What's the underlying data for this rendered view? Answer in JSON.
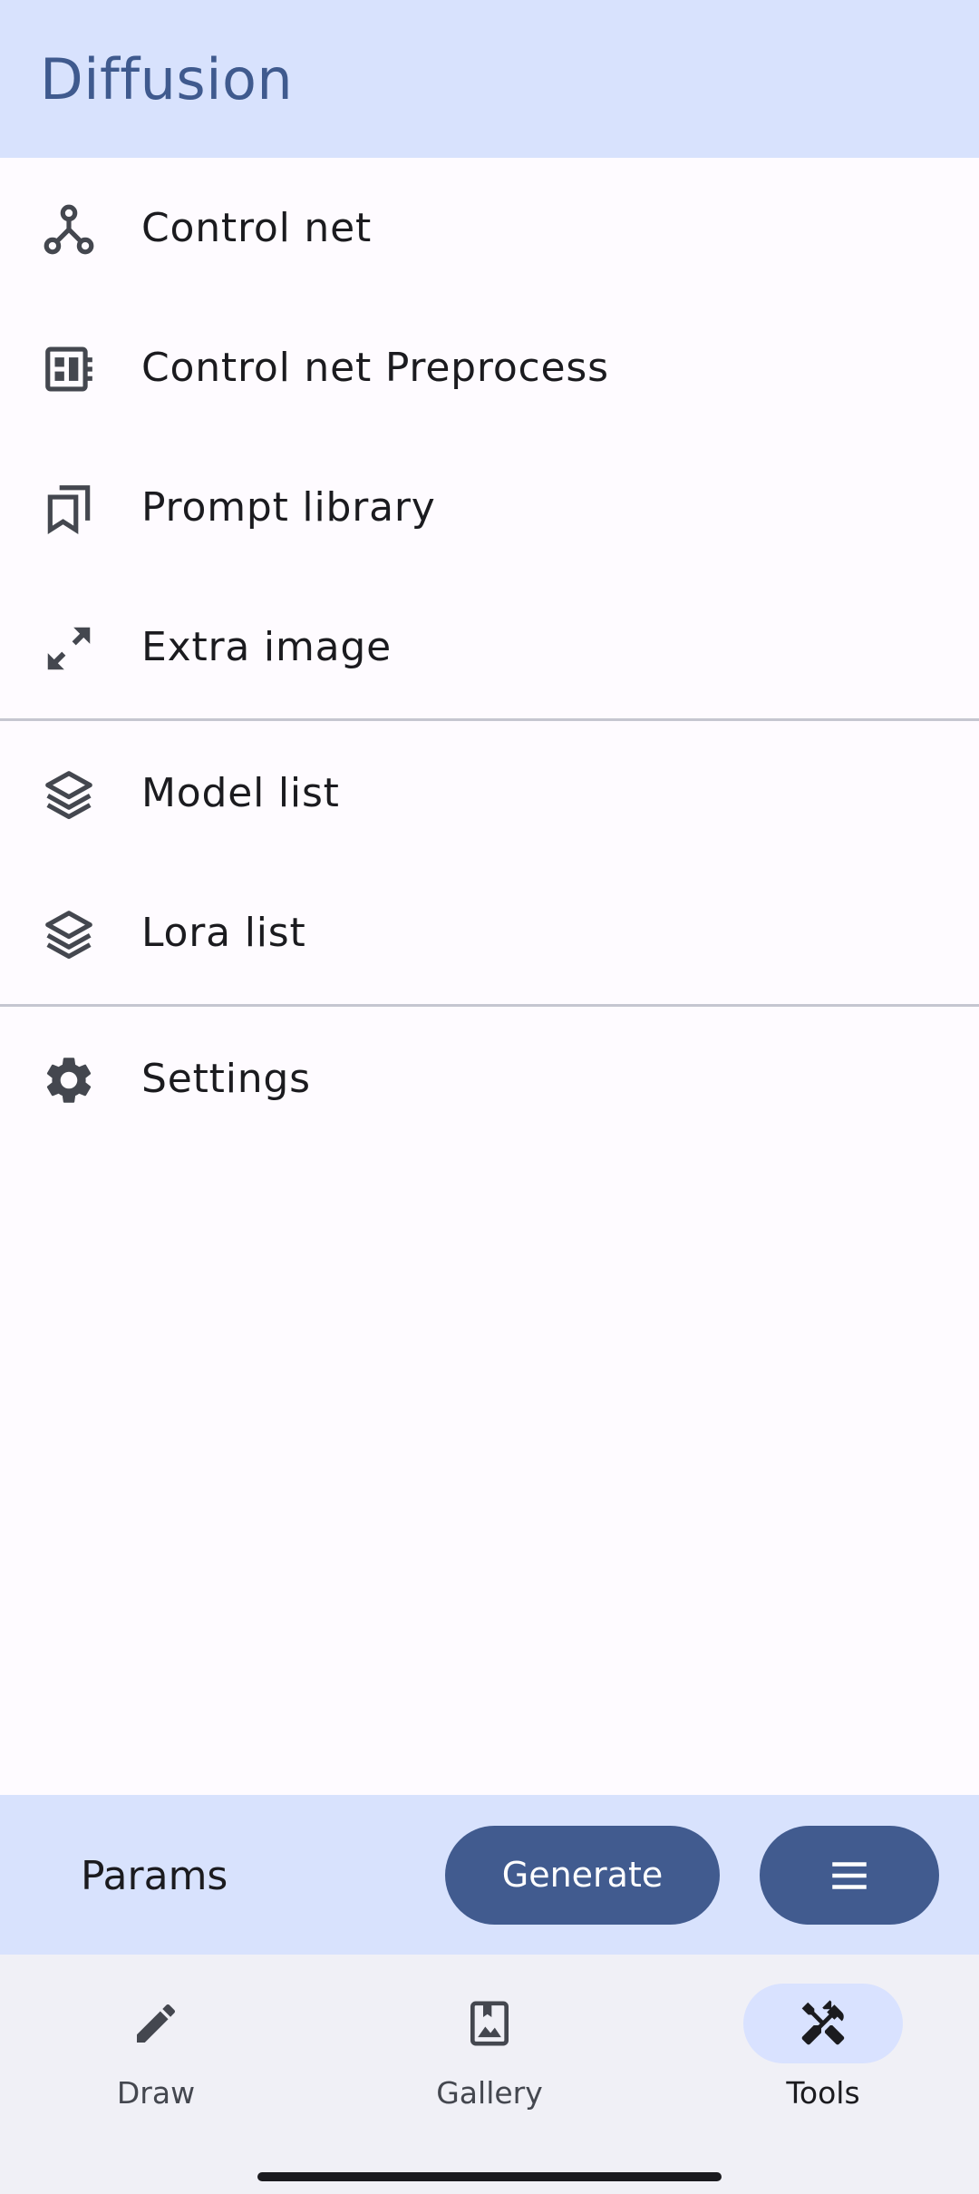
{
  "app_bar": {
    "title": "Diffusion"
  },
  "menu": {
    "groups": [
      {
        "items": [
          {
            "label": "Control net",
            "icon": "graph-nodes-icon"
          },
          {
            "label": "Control net Preprocess",
            "icon": "dashboard-chip-icon"
          },
          {
            "label": "Prompt library",
            "icon": "bookmarks-icon"
          },
          {
            "label": "Extra image",
            "icon": "expand-arrows-icon"
          }
        ]
      },
      {
        "items": [
          {
            "label": "Model list",
            "icon": "layers-icon"
          },
          {
            "label": "Lora list",
            "icon": "layers-icon"
          }
        ]
      },
      {
        "items": [
          {
            "label": "Settings",
            "icon": "gear-icon"
          }
        ]
      }
    ]
  },
  "bottom_bar": {
    "params_label": "Params",
    "generate_label": "Generate",
    "menu_icon": "hamburger-menu-icon"
  },
  "nav": {
    "items": [
      {
        "label": "Draw",
        "icon": "pencil-icon",
        "active": false
      },
      {
        "label": "Gallery",
        "icon": "photo-bookmark-icon",
        "active": false
      },
      {
        "label": "Tools",
        "icon": "tools-icon",
        "active": true
      }
    ]
  },
  "colors": {
    "app_bar_bg": "#d8e2fd",
    "title_color": "#3f5a8e",
    "accent_button": "#415b8f",
    "nav_bg": "#f0f0f6",
    "nav_active_pill": "#d9e2ff",
    "icon_color": "#44474f"
  }
}
